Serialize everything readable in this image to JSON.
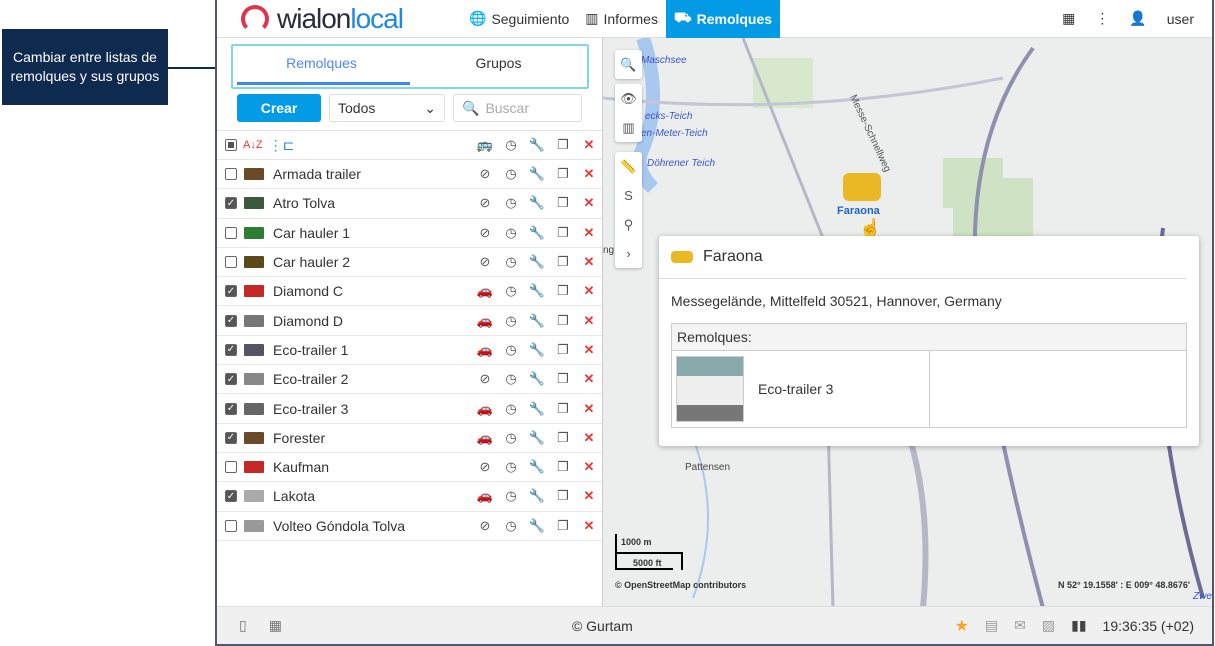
{
  "callout": "Cambiar entre listas de remolques y sus grupos",
  "topbar": {
    "logo": "wialon",
    "logo_local": "local",
    "nav": [
      {
        "label": "Seguimiento",
        "icon": "globe-icon"
      },
      {
        "label": "Informes",
        "icon": "report-icon"
      },
      {
        "label": "Remolques",
        "icon": "trailer-icon"
      }
    ],
    "user": "user"
  },
  "tabs": {
    "trailers": "Remolques",
    "groups": "Grupos"
  },
  "controls": {
    "create": "Crear",
    "filter": "Todos",
    "search_placeholder": "Buscar"
  },
  "rows": [
    {
      "name": "Armada trailer",
      "checked": false,
      "unit": "unlinked"
    },
    {
      "name": "Atro Tolva",
      "checked": true,
      "unit": "unlinked"
    },
    {
      "name": "Car hauler 1",
      "checked": false,
      "unit": "unlinked"
    },
    {
      "name": "Car hauler 2",
      "checked": false,
      "unit": "unlinked"
    },
    {
      "name": "Diamond C",
      "checked": true,
      "unit": "car"
    },
    {
      "name": "Diamond D",
      "checked": true,
      "unit": "car"
    },
    {
      "name": "Eco-trailer 1",
      "checked": true,
      "unit": "car"
    },
    {
      "name": "Eco-trailer 2",
      "checked": true,
      "unit": "unlinked"
    },
    {
      "name": "Eco-trailer 3",
      "checked": true,
      "unit": "car"
    },
    {
      "name": "Forester",
      "checked": true,
      "unit": "car"
    },
    {
      "name": "Kaufman",
      "checked": false,
      "unit": "unlinked"
    },
    {
      "name": "Lakota",
      "checked": true,
      "unit": "car"
    },
    {
      "name": "Volteo Góndola Tolva",
      "checked": false,
      "unit": "unlinked"
    }
  ],
  "map": {
    "labels": [
      "Maschsee",
      "ecks-Teich",
      "en-Meter-Teich",
      "Döhrener Teich",
      "Messe-Schnellweg",
      "Pattensen",
      "Zwe",
      "ng"
    ],
    "unit_label": "Faraona",
    "scale_m": "1000 m",
    "scale_ft": "5000 ft",
    "attribution": "© OpenStreetMap contributors",
    "coords": "N 52° 19.1558' : E 009° 48.8676'"
  },
  "popup": {
    "title": "Faraona",
    "address": "Messegelände, Mittelfeld 30521, Hannover, Germany",
    "section": "Remolques:",
    "trailer": "Eco-trailer 3"
  },
  "bottom": {
    "copyright": "© Gurtam",
    "time": "19:36:35 (+02)"
  }
}
